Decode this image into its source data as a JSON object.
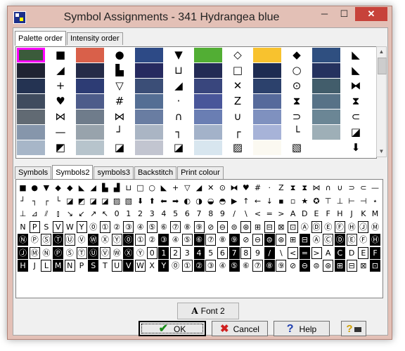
{
  "window": {
    "title": "Symbol Assignments - 341 Hydrangea blue",
    "controls": {
      "minimize": "─",
      "maximize": "☐",
      "close": "✕"
    }
  },
  "top_tabs": [
    {
      "label": "Palette order",
      "active": true
    },
    {
      "label": "Intensity order",
      "active": false
    }
  ],
  "palette": {
    "selected_index": 0,
    "rows": [
      [
        {
          "color": "#3b5b3b"
        },
        {
          "sym": "■"
        },
        {
          "color": "#d9604a"
        },
        {
          "sym": "●"
        },
        {
          "color": "#2d4a86"
        },
        {
          "sym": "▼"
        },
        {
          "color": "#52ae34"
        },
        {
          "sym": "◇"
        },
        {
          "color": "#f8c22e"
        },
        {
          "sym": "◆"
        },
        {
          "color": "#2f4f80"
        },
        {
          "sym": "◣"
        }
      ],
      [
        {
          "color": "#1f2333"
        },
        {
          "sym": "◢"
        },
        {
          "color": "#252b48"
        },
        {
          "sym": "▙"
        },
        {
          "color": "#262a60"
        },
        {
          "sym": "⊔"
        },
        {
          "color": "#232b55"
        },
        {
          "sym": "□"
        },
        {
          "color": "#1e2c52"
        },
        {
          "sym": "○"
        },
        {
          "color": "#25325f"
        },
        {
          "sym": "◣"
        }
      ],
      [
        {
          "color": "#243352"
        },
        {
          "sym": "+"
        },
        {
          "color": "#2d3c74"
        },
        {
          "sym": "▽"
        },
        {
          "color": "#3b4e77"
        },
        {
          "sym": "◢"
        },
        {
          "color": "#39467d"
        },
        {
          "sym": "✕"
        },
        {
          "color": "#2c416c"
        },
        {
          "sym": "⊙"
        },
        {
          "color": "#425d6b"
        },
        {
          "sym": "⧓"
        }
      ],
      [
        {
          "color": "#3f4b5e"
        },
        {
          "sym": "♥"
        },
        {
          "color": "#4d5c8a"
        },
        {
          "sym": "#"
        },
        {
          "color": "#546e94"
        },
        {
          "sym": "·"
        },
        {
          "color": "#49569a"
        },
        {
          "sym": "Z"
        },
        {
          "color": "#566a9b"
        },
        {
          "sym": "⧗"
        },
        {
          "color": "#577287"
        },
        {
          "sym": "⧗"
        }
      ],
      [
        {
          "color": "#616a73"
        },
        {
          "sym": "⋈"
        },
        {
          "color": "#6f7c8b"
        },
        {
          "sym": "⋈"
        },
        {
          "color": "#697da2"
        },
        {
          "sym": "∩"
        },
        {
          "color": "#6a7eb3"
        },
        {
          "sym": "∪"
        },
        {
          "color": "#7f91bf"
        },
        {
          "sym": "⊃"
        },
        {
          "color": "#6b8695"
        },
        {
          "sym": "⊂"
        }
      ],
      [
        {
          "color": "#8696ab"
        },
        {
          "sym": "—"
        },
        {
          "color": "#98a3ac"
        },
        {
          "sym": "┘"
        },
        {
          "color": "#aab5c4"
        },
        {
          "sym": "┐"
        },
        {
          "color": "#a3b2c9"
        },
        {
          "sym": "┌"
        },
        {
          "color": "#a7b3d8"
        },
        {
          "sym": "└"
        },
        {
          "color": "#9eafb7"
        },
        {
          "sym": "◪"
        }
      ],
      [
        {
          "color": "#a7b6c8"
        },
        {
          "sym": "◩"
        },
        {
          "color": "#b7c4cc"
        },
        {
          "sym": "◪"
        },
        {
          "color": "#c2c5d0"
        },
        {
          "sym": "◪"
        },
        {
          "color": "#d8e6ef"
        },
        {
          "sym": "▨"
        },
        {
          "color": "#fbf9f1"
        },
        {
          "sym": "▧"
        },
        {
          "color": "#ffffff"
        },
        {
          "sym": "⬇"
        }
      ]
    ]
  },
  "lower_tabs": [
    {
      "label": "Symbols",
      "active": false
    },
    {
      "label": "Symbols2",
      "active": true
    },
    {
      "label": "symbols3",
      "active": false
    },
    {
      "label": "Backstitch",
      "active": false
    },
    {
      "label": "Print colour",
      "active": false
    }
  ],
  "symbol_rows": [
    [
      "■",
      "●",
      "▼",
      "◆",
      "◆",
      "◣",
      "◢",
      "▙",
      "▟",
      "⊔",
      "□",
      "○",
      "◣",
      "+",
      "▽",
      "◢",
      "✕",
      "⊙",
      "⧓",
      "♥",
      "#",
      "·",
      "Z",
      "⧗",
      "⧗",
      "⋈",
      "∩",
      "∪",
      "⊃",
      "⊂",
      "—"
    ],
    [
      "┘",
      "┐",
      "┌",
      "└",
      "◪",
      "◩",
      "◪",
      "◪",
      "▨",
      "▧",
      "⬇",
      "⬆",
      "⬅",
      "➡",
      "◐",
      "◑",
      "◒",
      "◓",
      "▶",
      "↑",
      "←",
      "↓",
      "▪",
      "▫",
      "★",
      "✪",
      "⊤",
      "⊥",
      "⊢",
      "⊣",
      "⋆"
    ],
    [
      "⊥",
      "⊿",
      "⫽",
      "⫾",
      "↘",
      "↙",
      "↗",
      "↖",
      "0",
      "1",
      "2",
      "3",
      "4",
      "5",
      "6",
      "7",
      "8",
      "9",
      "/",
      "\\",
      "<",
      "=",
      ">",
      "A",
      "D",
      "E",
      "F",
      "H",
      "J",
      "K",
      "M"
    ],
    [
      "N",
      "P",
      "S",
      "V",
      "W",
      "Y",
      "⓪",
      "①",
      "②",
      "③",
      "④",
      "⑤",
      "⑥",
      "⑦",
      "⑧",
      "⑨",
      "⊘",
      "⊖",
      "⊜",
      "⊛",
      "⊞",
      "⊟",
      "⊠",
      "⊡",
      "Ⓐ",
      "Ⓓ",
      "Ⓔ",
      "Ⓕ",
      "Ⓗ",
      "Ⓙ",
      "Ⓜ"
    ],
    [
      "Ⓝ",
      "Ⓟ",
      "Ⓢ",
      "Ⓣ",
      "Ⓤ",
      "Ⓥ",
      "Ⓦ",
      "Ⓧ",
      "Ⓨ",
      "⓪",
      "①",
      "②",
      "③",
      "④",
      "⑤",
      "⑥",
      "⑦",
      "⑧",
      "⑨",
      "⊘",
      "⊖",
      "⊜",
      "⊛",
      "⊞",
      "⊟",
      "Ⓐ",
      "Ⓒ",
      "Ⓓ",
      "Ⓔ",
      "Ⓕ",
      "Ⓗ"
    ],
    [
      "Ⓙ",
      "Ⓜ",
      "Ⓝ",
      "Ⓟ",
      "Ⓢ",
      "Ⓣ",
      "Ⓤ",
      "Ⓥ",
      "Ⓦ",
      "Ⓧ",
      "Ⓨ",
      "0",
      "1",
      "2",
      "3",
      "4",
      "5",
      "6",
      "7",
      "8",
      "9",
      "/",
      "\\",
      "<",
      "=",
      ">",
      "A",
      "C",
      "D",
      "E",
      "F"
    ],
    [
      "H",
      "J",
      "L",
      "M",
      "N",
      "P",
      "S",
      "T",
      "U",
      "V",
      "W",
      "X",
      "Y",
      "⓪",
      "①",
      "②",
      "③",
      "④",
      "⑤",
      "⑥",
      "⑦",
      "⑧",
      "⑨",
      "⊘",
      "⊖",
      "⊜",
      "⊛",
      "⊞",
      "⊟",
      "⊠",
      "⊡"
    ]
  ],
  "font_button": {
    "icon": "A",
    "label": "Font 2"
  },
  "buttons": {
    "ok": "OK",
    "cancel": "Cancel",
    "help": "Help",
    "wizard": "?"
  }
}
